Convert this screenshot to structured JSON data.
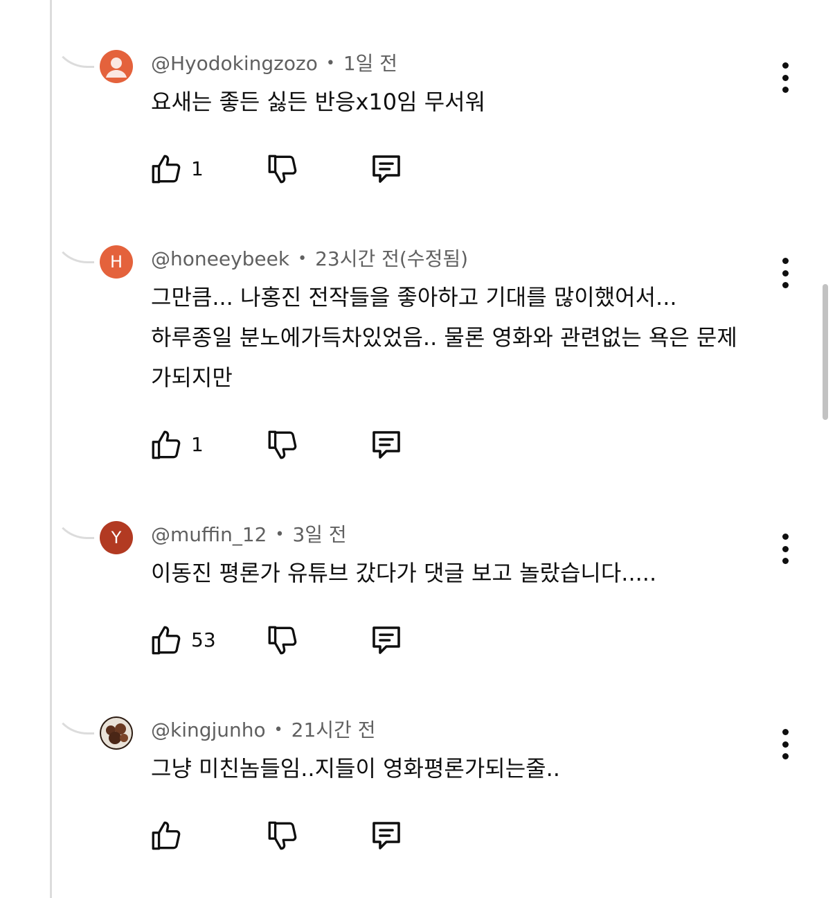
{
  "comments": [
    {
      "handle": "@Hyodokingzozo",
      "time": "1일 전",
      "avatar_letter": "",
      "avatar_color": "#e4623c",
      "lines": [
        "요새는 좋든 싫든 반응x10임 무서워"
      ],
      "likes": "1"
    },
    {
      "handle": "@honeeybeek",
      "time": "23시간 전(수정됨)",
      "avatar_letter": "H",
      "avatar_color": "#e4623c",
      "lines": [
        "그만큼... 나홍진 전작들을 좋아하고 기대를 많이했어서...",
        "하루종일 분노에가득차있었음.. 물론 영화와 관련없는 욕은 문제",
        "가되지만"
      ],
      "likes": "1"
    },
    {
      "handle": "@muffin_12",
      "time": "3일 전",
      "avatar_letter": "Y",
      "avatar_color": "#b23a22",
      "lines": [
        "이동진 평론가 유튜브 갔다가 댓글 보고 놀랐습니다....."
      ],
      "likes": "53"
    },
    {
      "handle": "@kingjunho",
      "time": "21시간 전",
      "avatar_letter": "",
      "avatar_color": "#5a3a28",
      "lines": [
        "그냥 미친놈들임..지들이 영화평론가되는줄.."
      ],
      "likes": ""
    }
  ],
  "icons": {
    "like": "thumbs-up-icon",
    "dislike": "thumbs-down-icon",
    "reply": "reply-bubble-icon",
    "more": "more-vertical-icon",
    "person": "person-icon"
  },
  "colors": {
    "text": "#0f0f0f",
    "meta": "#606060",
    "thread": "#dcdcdc"
  }
}
